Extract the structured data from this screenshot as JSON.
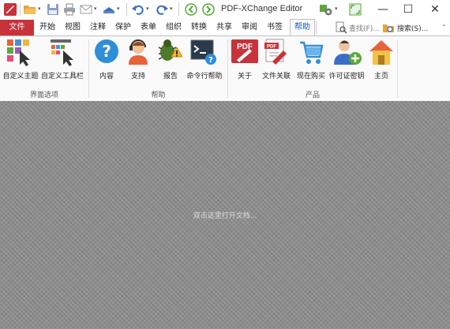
{
  "window": {
    "title": "PDF-XChange Editor",
    "minimize_glyph": "—",
    "maximize_glyph": "☐",
    "close_glyph": "✕"
  },
  "quick_access": [
    "app-logo-icon",
    "open-folder-icon",
    "save-icon",
    "print-icon",
    "email-icon",
    "scan-icon",
    "undo-icon",
    "redo-icon",
    "back-icon",
    "forward-icon",
    "settings-icon",
    "fullscreen-icon"
  ],
  "menu": {
    "file": "文件",
    "tabs": [
      "开始",
      "视图",
      "注释",
      "保护",
      "表单",
      "组织",
      "转换",
      "共享",
      "审阅",
      "书签"
    ],
    "active": "帮助",
    "find": "查找(F)...",
    "search": "搜索(S)..."
  },
  "ribbon": {
    "groups": [
      {
        "label": "界面选项",
        "buttons": [
          {
            "label": "自定义主题",
            "icon": "theme-icon"
          },
          {
            "label": "自定义工具栏",
            "icon": "toolbar-icon"
          }
        ]
      },
      {
        "label": "帮助",
        "buttons": [
          {
            "label": "内容",
            "icon": "help-icon"
          },
          {
            "label": "支持",
            "icon": "support-icon"
          },
          {
            "label": "报告",
            "icon": "bug-report-icon"
          },
          {
            "label": "命令行帮助",
            "icon": "command-line-icon"
          }
        ]
      },
      {
        "label": "产品",
        "buttons": [
          {
            "label": "关于",
            "icon": "pdf-about-icon"
          },
          {
            "label": "文件关联",
            "icon": "file-association-icon"
          },
          {
            "label": "现在购买",
            "icon": "cart-icon"
          },
          {
            "label": "许可证密钥",
            "icon": "license-key-icon"
          },
          {
            "label": "主页",
            "icon": "home-icon"
          }
        ]
      }
    ]
  },
  "workspace": {
    "hint": "双击这里打开文档..."
  },
  "colors": {
    "file_tab": "#c8323a",
    "accent": "#1a5fb4",
    "workspace": "#8f8f8f"
  }
}
